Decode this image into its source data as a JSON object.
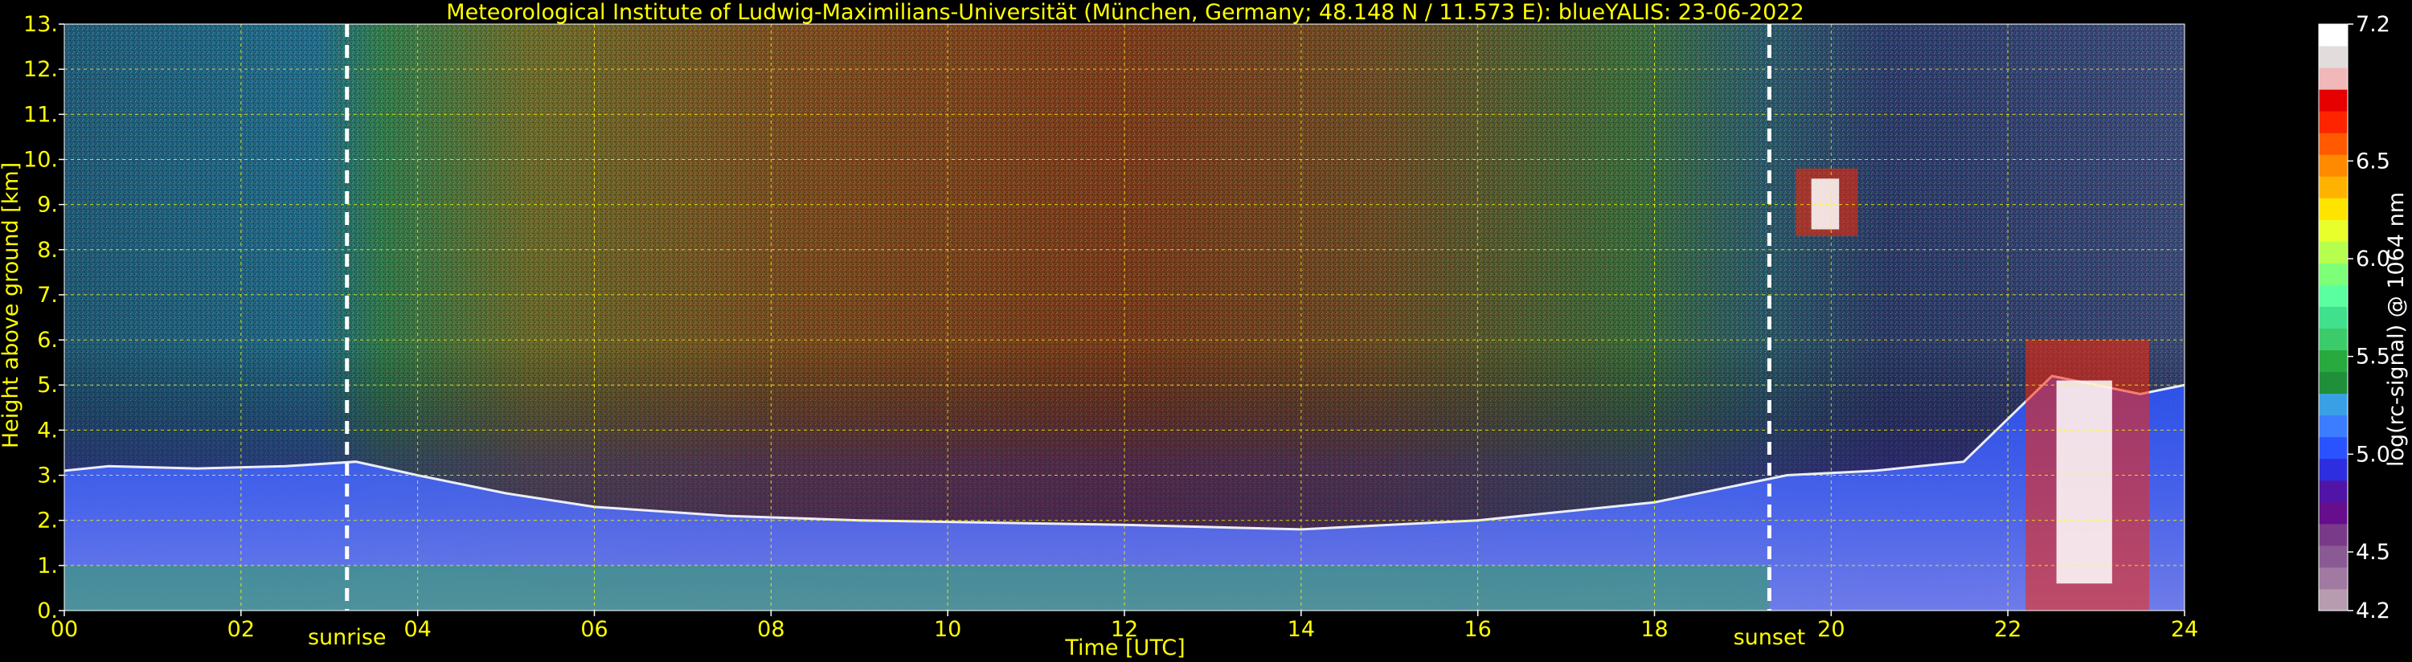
{
  "chart_data": {
    "type": "heatmap",
    "title": "Meteorological Institute of Ludwig-Maximilians-Universität (München, Germany; 48.148 N / 11.573 E):    blueYALIS: 23-06-2022",
    "xlabel": "Time [UTC]",
    "ylabel": "Height above ground [km]",
    "xlim": [
      0,
      24
    ],
    "ylim": [
      0,
      13
    ],
    "x_ticks": [
      "00",
      "02",
      "04",
      "06",
      "08",
      "10",
      "12",
      "14",
      "16",
      "18",
      "20",
      "22",
      "24"
    ],
    "y_ticks": [
      "0.",
      "1.",
      "2.",
      "3.",
      "4.",
      "5.",
      "6.",
      "7.",
      "8.",
      "9.",
      "10.",
      "11.",
      "12.",
      "13."
    ],
    "grid": true,
    "colorbar": {
      "label": "log(rc-signal) @ 1064 nm",
      "range": [
        4.2,
        7.2
      ],
      "tick_labels": [
        "4.2",
        "4.5",
        "5.0",
        "5.5",
        "6.0",
        "6.5",
        "7.2"
      ],
      "ticks": [
        4.2,
        4.5,
        5.0,
        5.5,
        6.0,
        6.5,
        7.2
      ],
      "colors": [
        "#b69cae",
        "#a07aa0",
        "#8a5a94",
        "#7a3a8a",
        "#660e8c",
        "#5015a6",
        "#2c2ee0",
        "#2a53ff",
        "#3c7cff",
        "#3aa0e6",
        "#1f8f3a",
        "#28aa3e",
        "#3ccb6a",
        "#41e08c",
        "#5aff9f",
        "#7dff78",
        "#b6ff4e",
        "#e8ff2b",
        "#ffe400",
        "#ffb300",
        "#ff8a00",
        "#ff5a00",
        "#ff2400",
        "#e60000",
        "#f0b8b8",
        "#e2dcdc",
        "#ffffff"
      ]
    },
    "annotations": [
      {
        "text": "sunrise",
        "x": 3.2
      },
      {
        "text": "sunset",
        "x": 19.3
      }
    ],
    "features": [
      {
        "type": "boundary_layer_top",
        "points": [
          [
            0,
            3.1
          ],
          [
            0.5,
            3.2
          ],
          [
            1.5,
            3.15
          ],
          [
            2.5,
            3.2
          ],
          [
            3.3,
            3.3
          ],
          [
            4.0,
            3.0
          ],
          [
            5,
            2.6
          ],
          [
            6,
            2.3
          ],
          [
            7.5,
            2.1
          ],
          [
            9,
            2.0
          ],
          [
            12,
            1.9
          ],
          [
            14,
            1.8
          ],
          [
            16,
            2.0
          ],
          [
            18,
            2.4
          ],
          [
            19.5,
            3.0
          ],
          [
            20.5,
            3.1
          ],
          [
            21.5,
            3.3
          ],
          [
            22.5,
            5.2
          ],
          [
            23.5,
            4.8
          ],
          [
            24,
            5.0
          ]
        ]
      },
      {
        "type": "cloud",
        "time": [
          19.6,
          20.3
        ],
        "height": [
          8.3,
          9.8
        ]
      },
      {
        "type": "cloud",
        "time": [
          22.2,
          23.6
        ],
        "height": [
          0.0,
          6.0
        ]
      }
    ],
    "text_color": "#ffff00"
  }
}
